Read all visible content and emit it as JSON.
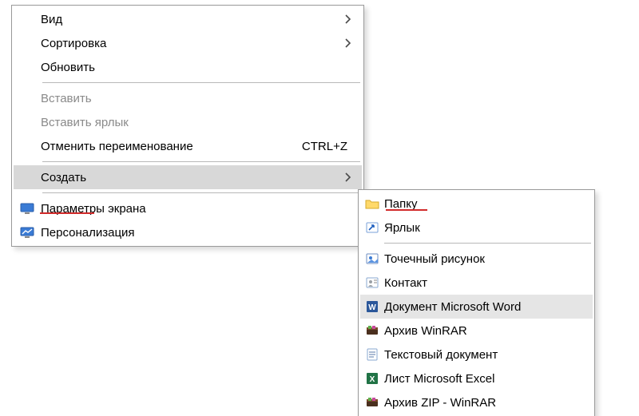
{
  "main_menu": {
    "view": "Вид",
    "sort": "Сортировка",
    "refresh": "Обновить",
    "paste": "Вставить",
    "paste_shortcut": "Вставить ярлык",
    "undo_rename": "Отменить переименование",
    "undo_rename_key": "CTRL+Z",
    "create": "Создать",
    "display_settings": "Параметры экрана",
    "personalize": "Персонализация"
  },
  "sub_menu": {
    "folder": "Папку",
    "shortcut": "Ярлык",
    "bitmap": "Точечный рисунок",
    "contact": "Контакт",
    "word_doc": "Документ Microsoft Word",
    "winrar": "Архив WinRAR",
    "text_doc": "Текстовый документ",
    "excel": "Лист Microsoft Excel",
    "winrar_zip": "Архив ZIP - WinRAR"
  }
}
